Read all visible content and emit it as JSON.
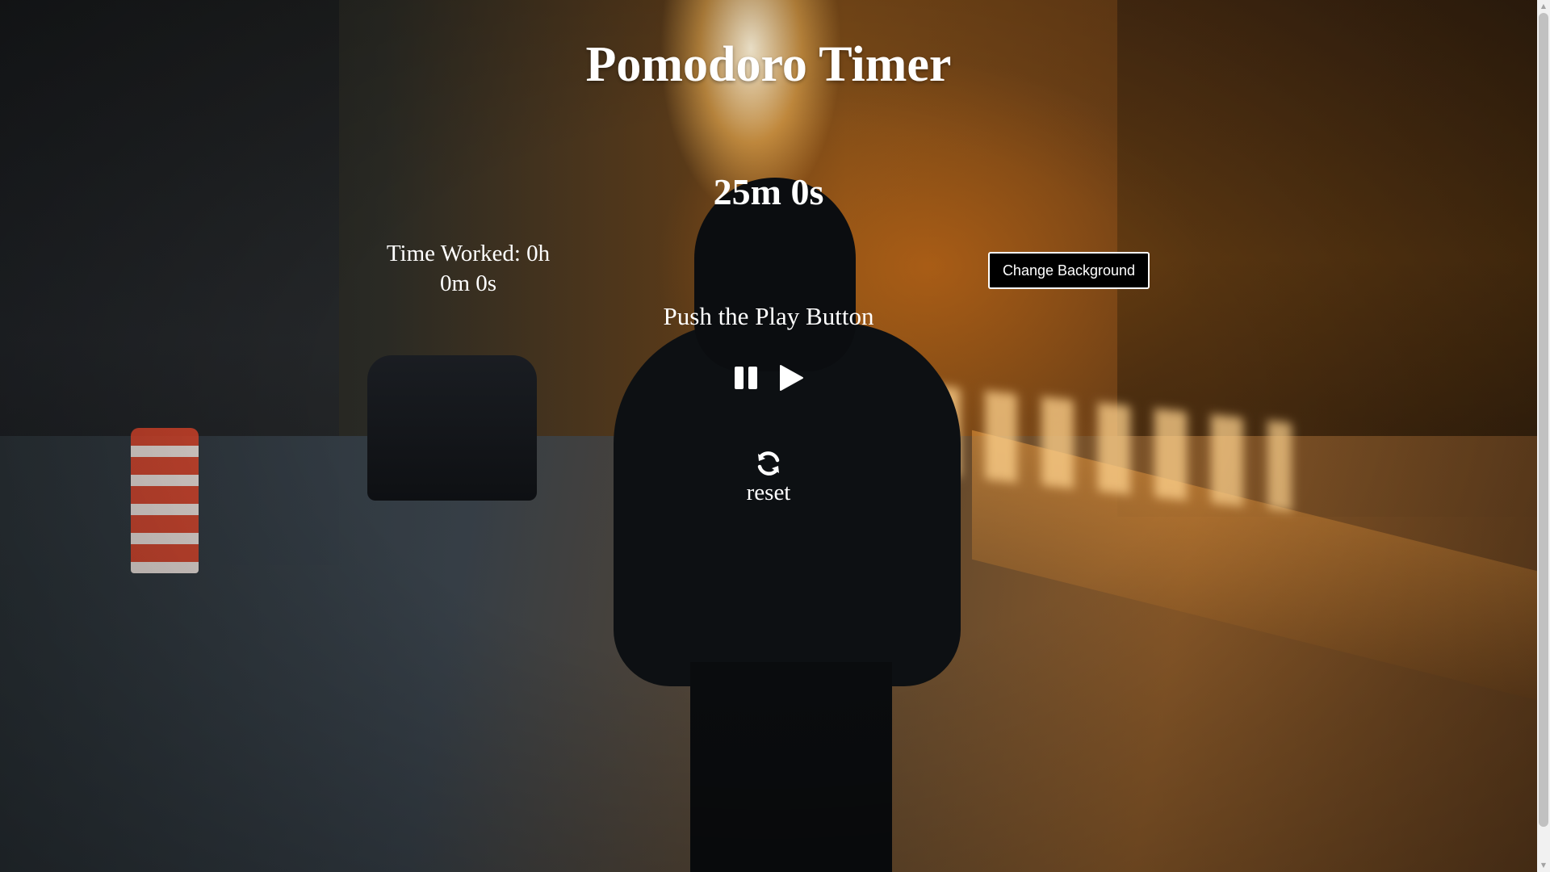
{
  "header": {
    "title": "Pomodoro Timer"
  },
  "timer": {
    "display": "25m 0s",
    "status": "Push the Play Button"
  },
  "stats": {
    "time_worked_line1": "Time Worked: 0h",
    "time_worked_line2": "0m 0s"
  },
  "actions": {
    "change_background_label": "Change Background",
    "reset_label": "reset"
  },
  "icons": {
    "pause": "pause-icon",
    "play": "play-icon",
    "reset": "refresh-icon"
  },
  "colors": {
    "text": "#ffffff",
    "button_bg": "#000000",
    "button_border": "#ffffff"
  }
}
